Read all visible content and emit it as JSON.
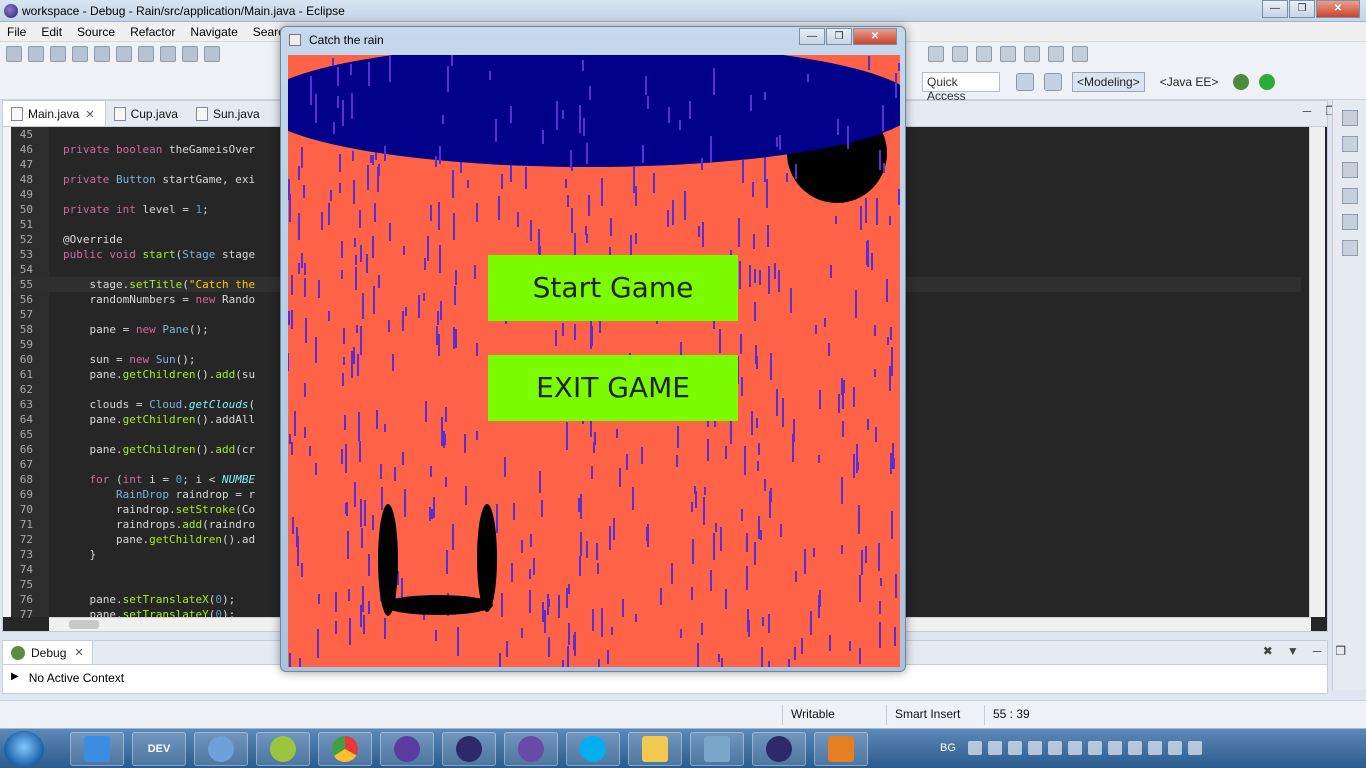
{
  "titlebar": {
    "title": "workspace - Debug - Rain/src/application/Main.java - Eclipse"
  },
  "menus": [
    "File",
    "Edit",
    "Source",
    "Refactor",
    "Navigate",
    "Search"
  ],
  "toolbar": {
    "quick_access": "Quick Access",
    "perspectives": [
      "<Modeling>",
      "<Java EE>"
    ]
  },
  "editor": {
    "tabs": [
      {
        "label": "Main.java",
        "active": true
      },
      {
        "label": "Cup.java",
        "active": false
      },
      {
        "label": "Sun.java",
        "active": false
      }
    ],
    "lines": [
      {
        "n": "45",
        "code": ""
      },
      {
        "n": "46",
        "code": "private boolean theGameisOver"
      },
      {
        "n": "47",
        "code": ""
      },
      {
        "n": "48",
        "code": "private Button startGame, exi"
      },
      {
        "n": "49",
        "code": ""
      },
      {
        "n": "50",
        "code": "private int level = 1;"
      },
      {
        "n": "51",
        "code": ""
      },
      {
        "n": "52",
        "code": "@Override"
      },
      {
        "n": "53",
        "code": "public void start(Stage stage"
      },
      {
        "n": "54",
        "code": ""
      },
      {
        "n": "55",
        "code": "    stage.setTitle(\"Catch the"
      },
      {
        "n": "56",
        "code": "    randomNumbers = new Rando"
      },
      {
        "n": "57",
        "code": ""
      },
      {
        "n": "58",
        "code": "    pane = new Pane();"
      },
      {
        "n": "59",
        "code": ""
      },
      {
        "n": "60",
        "code": "    sun = new Sun();"
      },
      {
        "n": "61",
        "code": "    pane.getChildren().add(su"
      },
      {
        "n": "62",
        "code": ""
      },
      {
        "n": "63",
        "code": "    clouds = Cloud.getClouds("
      },
      {
        "n": "64",
        "code": "    pane.getChildren().addAll"
      },
      {
        "n": "65",
        "code": ""
      },
      {
        "n": "66",
        "code": "    pane.getChildren().add(cr"
      },
      {
        "n": "67",
        "code": ""
      },
      {
        "n": "68",
        "code": "    for (int i = 0; i < NUMBE"
      },
      {
        "n": "69",
        "code": "        RainDrop raindrop = r"
      },
      {
        "n": "70",
        "code": "        raindrop.setStroke(Co"
      },
      {
        "n": "71",
        "code": "        raindrops.add(raindro"
      },
      {
        "n": "72",
        "code": "        pane.getChildren().ad"
      },
      {
        "n": "73",
        "code": "    }"
      },
      {
        "n": "74",
        "code": ""
      },
      {
        "n": "75",
        "code": ""
      },
      {
        "n": "76",
        "code": "    pane.setTranslateX(0);"
      },
      {
        "n": "77",
        "code": "    pane.setTranslateY(0);"
      }
    ]
  },
  "debug": {
    "tab_label": "Debug",
    "context": "No Active Context"
  },
  "status": {
    "writable": "Writable",
    "insert_mode": "Smart Insert",
    "position": "55 : 39"
  },
  "taskbar": {
    "lang": "BG",
    "items": [
      "DEV",
      "",
      "",
      "",
      "",
      "",
      "",
      "",
      "",
      "",
      "",
      ""
    ]
  },
  "game_window": {
    "title": "Catch the rain",
    "start_button": "Start Game",
    "exit_button": "EXIT GAME",
    "colors": {
      "background": "#ff6347",
      "cloud": "#00008b",
      "rain": "#5a2ecf",
      "button": "#7cfc00",
      "cup": "#000000"
    }
  }
}
